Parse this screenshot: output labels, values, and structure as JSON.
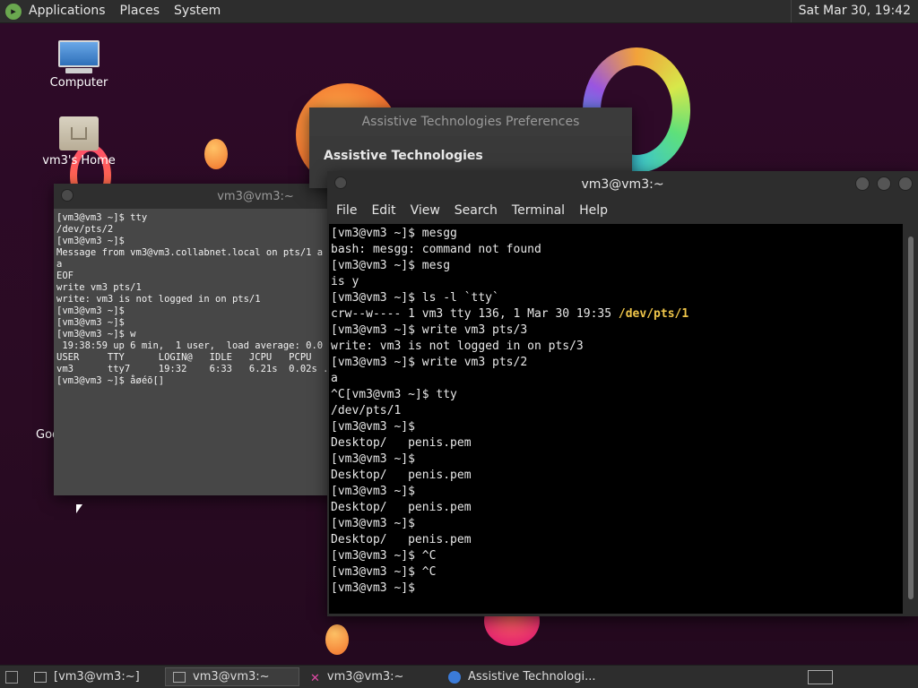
{
  "top_panel": {
    "menus": [
      "Applications",
      "Places",
      "System"
    ],
    "clock": "Sat Mar 30, 19:42"
  },
  "desktop": {
    "icons": [
      {
        "label": "Computer"
      },
      {
        "label": "vm3's Home"
      }
    ],
    "partial_icon_label": "Goo"
  },
  "back_terminal": {
    "title": "vm3@vm3:~",
    "lines": [
      "[vm3@vm3 ~]$ tty",
      "/dev/pts/2",
      "[vm3@vm3 ~]$",
      "Message from vm3@vm3.collabnet.local on pts/1 a",
      "a",
      "EOF",
      "write vm3 pts/1",
      "write: vm3 is not logged in on pts/1",
      "[vm3@vm3 ~]$",
      "[vm3@vm3 ~]$",
      "[vm3@vm3 ~]$ w",
      " 19:38:59 up 6 min,  1 user,  load average: 0.0",
      "USER     TTY      LOGIN@   IDLE   JCPU   PCPU",
      "vm3      tty7     19:32    6:33   6.21s  0.02s ...",
      "[vm3@vm3 ~]$ åøéõ[]"
    ]
  },
  "prefs_window": {
    "title": "Assistive Technologies Preferences",
    "heading": "Assistive Technologies"
  },
  "front_terminal": {
    "title": "vm3@vm3:~",
    "menu": [
      "File",
      "Edit",
      "View",
      "Search",
      "Terminal",
      "Help"
    ],
    "lines": [
      {
        "text": "[vm3@vm3 ~]$ mesgg"
      },
      {
        "text": "bash: mesgg: command not found"
      },
      {
        "text": "[vm3@vm3 ~]$ mesg"
      },
      {
        "text": "is y"
      },
      {
        "text": "[vm3@vm3 ~]$ ls -l `tty`"
      },
      {
        "text": "crw--w---- 1 vm3 tty 136, 1 Mar 30 19:35 ",
        "highlight": "/dev/pts/1"
      },
      {
        "text": "[vm3@vm3 ~]$ write vm3 pts/3"
      },
      {
        "text": "write: vm3 is not logged in on pts/3"
      },
      {
        "text": "[vm3@vm3 ~]$ write vm3 pts/2"
      },
      {
        "text": "a"
      },
      {
        "text": "^C[vm3@vm3 ~]$ tty"
      },
      {
        "text": "/dev/pts/1"
      },
      {
        "text": "[vm3@vm3 ~]$"
      },
      {
        "text": "Desktop/   penis.pem"
      },
      {
        "text": "[vm3@vm3 ~]$"
      },
      {
        "text": "Desktop/   penis.pem"
      },
      {
        "text": "[vm3@vm3 ~]$"
      },
      {
        "text": "Desktop/   penis.pem"
      },
      {
        "text": "[vm3@vm3 ~]$"
      },
      {
        "text": "Desktop/   penis.pem"
      },
      {
        "text": "[vm3@vm3 ~]$ ^C"
      },
      {
        "text": "[vm3@vm3 ~]$ ^C"
      },
      {
        "text": "[vm3@vm3 ~]$"
      }
    ]
  },
  "taskbar": {
    "tasks": [
      {
        "label": "[vm3@vm3:~]",
        "icon": "terminal-icon",
        "active": false
      },
      {
        "label": "vm3@vm3:~",
        "icon": "terminal-icon",
        "active": true
      },
      {
        "label": "vm3@vm3:~",
        "icon": "x-icon",
        "active": false
      },
      {
        "label": "Assistive Technologi...",
        "icon": "accessibility-icon",
        "active": false
      }
    ]
  },
  "colors": {
    "path_highlight": "#f0c64a",
    "desktop_bg": "#2e0a28"
  }
}
